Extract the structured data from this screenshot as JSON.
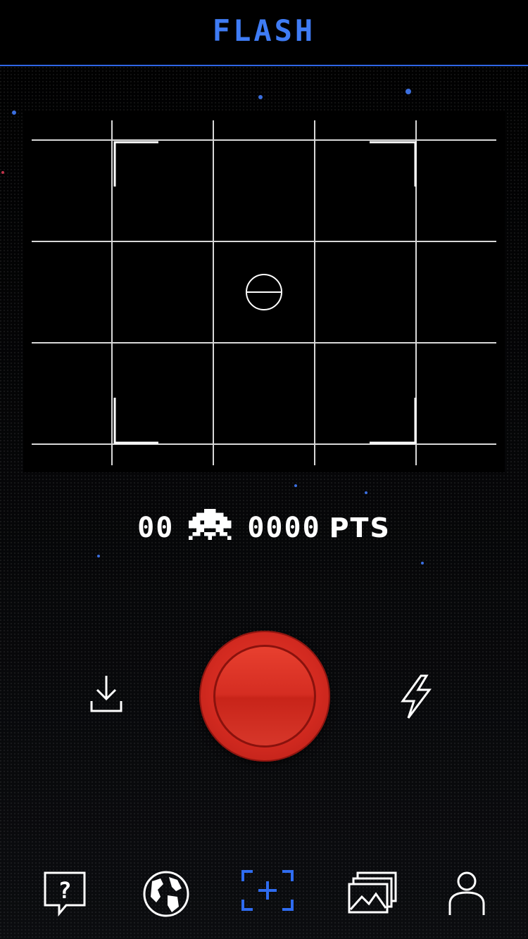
{
  "header": {
    "title": "FLASH"
  },
  "score": {
    "count": "00",
    "points": "0000",
    "unit": "PTS"
  },
  "colors": {
    "accent": "#3f7cf5",
    "shutter": "#d52d22",
    "grid": "#d8d8d8"
  },
  "controls": {
    "left_icon": "download-icon",
    "center": "shutter-button",
    "right_icon": "flash-bolt-icon"
  },
  "tabbar": {
    "items": [
      {
        "icon": "help-icon",
        "active": false
      },
      {
        "icon": "globe-icon",
        "active": false
      },
      {
        "icon": "scan-add-icon",
        "active": true
      },
      {
        "icon": "gallery-icon",
        "active": false
      },
      {
        "icon": "profile-icon",
        "active": false
      }
    ]
  }
}
